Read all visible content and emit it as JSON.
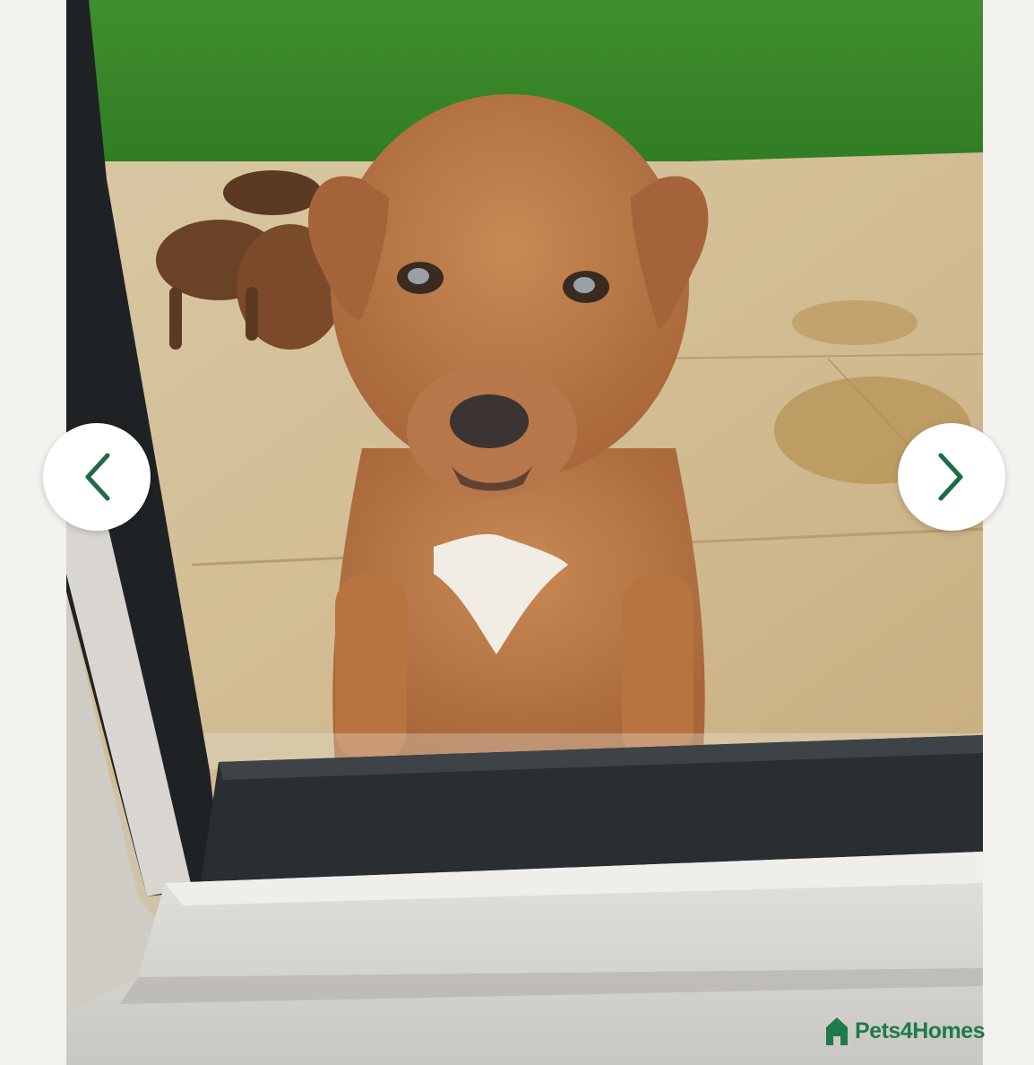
{
  "gallery": {
    "image": {
      "subject": "puppy-photo"
    },
    "prev_button": {
      "icon": "chevron-left-icon",
      "color": "#1f6b44"
    },
    "next_button": {
      "icon": "chevron-right-icon",
      "color": "#1f6b44"
    },
    "watermark": {
      "text": "Pets4Homes",
      "icon": "house-icon",
      "color": "#1f7a4a"
    }
  }
}
